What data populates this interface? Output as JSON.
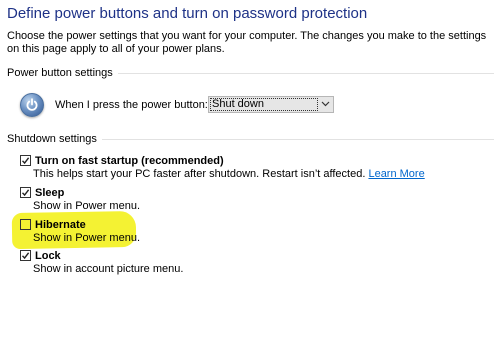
{
  "page": {
    "title": "Define power buttons and turn on password protection",
    "description": "Choose the power settings that you want for your computer. The changes you make to the settings on this page apply to all of your power plans."
  },
  "power_buttons": {
    "section_label": "Power button settings",
    "icon": "power-icon",
    "row_label": "When I press the power button:",
    "selected_value": "Shut down"
  },
  "shutdown": {
    "section_label": "Shutdown settings",
    "items": [
      {
        "label": "Turn on fast startup (recommended)",
        "checked": true,
        "description": "This helps start your PC faster after shutdown. Restart isn’t affected.",
        "link": "Learn More"
      },
      {
        "label": "Sleep",
        "checked": true,
        "description": "Show in Power menu."
      },
      {
        "label": "Hibernate",
        "checked": false,
        "description": "Show in Power menu.",
        "highlight_color": "#f4f233"
      },
      {
        "label": "Lock",
        "checked": true,
        "description": "Show in account picture menu."
      }
    ]
  },
  "colors": {
    "title": "#1e3287",
    "link": "#0066cc",
    "highlight": "#f4f233"
  }
}
